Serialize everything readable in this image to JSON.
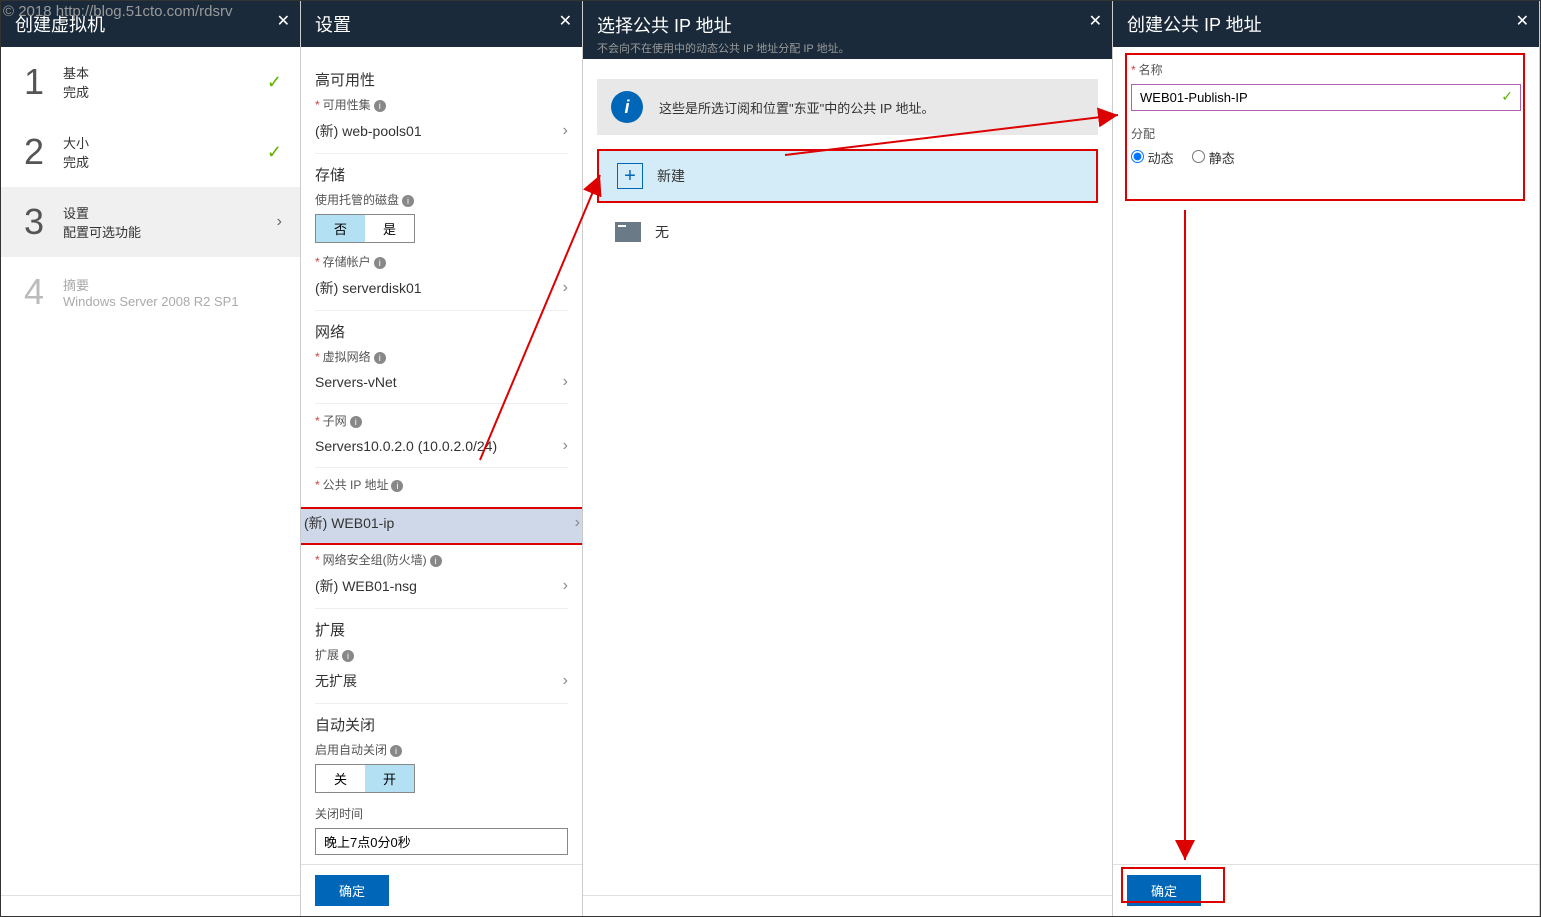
{
  "watermark": "© 2018 http://blog.51cto.com/rdsrv",
  "blade1": {
    "title": "创建虚拟机",
    "steps": [
      {
        "num": "1",
        "title": "基本",
        "sub": "完成",
        "status": "done"
      },
      {
        "num": "2",
        "title": "大小",
        "sub": "完成",
        "status": "done"
      },
      {
        "num": "3",
        "title": "设置",
        "sub": "配置可选功能",
        "status": "active"
      },
      {
        "num": "4",
        "title": "摘要",
        "sub": "Windows Server 2008 R2 SP1",
        "status": "disabled"
      }
    ]
  },
  "blade2": {
    "title": "设置",
    "sections": {
      "ha": {
        "heading": "高可用性",
        "avail_label": "可用性集",
        "avail_value": "(新) web-pools01"
      },
      "storage": {
        "heading": "存储",
        "managed_label": "使用托管的磁盘",
        "toggle_no": "否",
        "toggle_yes": "是",
        "account_label": "存储帐户",
        "account_value": "(新) serverdisk01"
      },
      "network": {
        "heading": "网络",
        "vnet_label": "虚拟网络",
        "vnet_value": "Servers-vNet",
        "subnet_label": "子网",
        "subnet_value": "Servers10.0.2.0 (10.0.2.0/24)",
        "pubip_label": "公共 IP 地址",
        "pubip_value": "(新) WEB01-ip",
        "nsg_label": "网络安全组(防火墙)",
        "nsg_value": "(新) WEB01-nsg"
      },
      "ext": {
        "heading": "扩展",
        "ext_label": "扩展",
        "ext_value": "无扩展"
      },
      "shutdown": {
        "heading": "自动关闭",
        "enable_label": "启用自动关闭",
        "off": "关",
        "on": "开",
        "time_label": "关闭时间",
        "time_value": "晚上7点0分0秒"
      }
    },
    "ok": "确定"
  },
  "blade3": {
    "title": "选择公共 IP 地址",
    "subtitle": "不会向不在使用中的动态公共 IP 地址分配 IP 地址。",
    "banner": "这些是所选订阅和位置\"东亚\"中的公共 IP 地址。",
    "new_label": "新建",
    "none_label": "无"
  },
  "blade4": {
    "title": "创建公共 IP 地址",
    "name_label": "名称",
    "name_value": "WEB01-Publish-IP",
    "alloc_label": "分配",
    "dynamic": "动态",
    "static": "静态",
    "ok": "确定"
  }
}
